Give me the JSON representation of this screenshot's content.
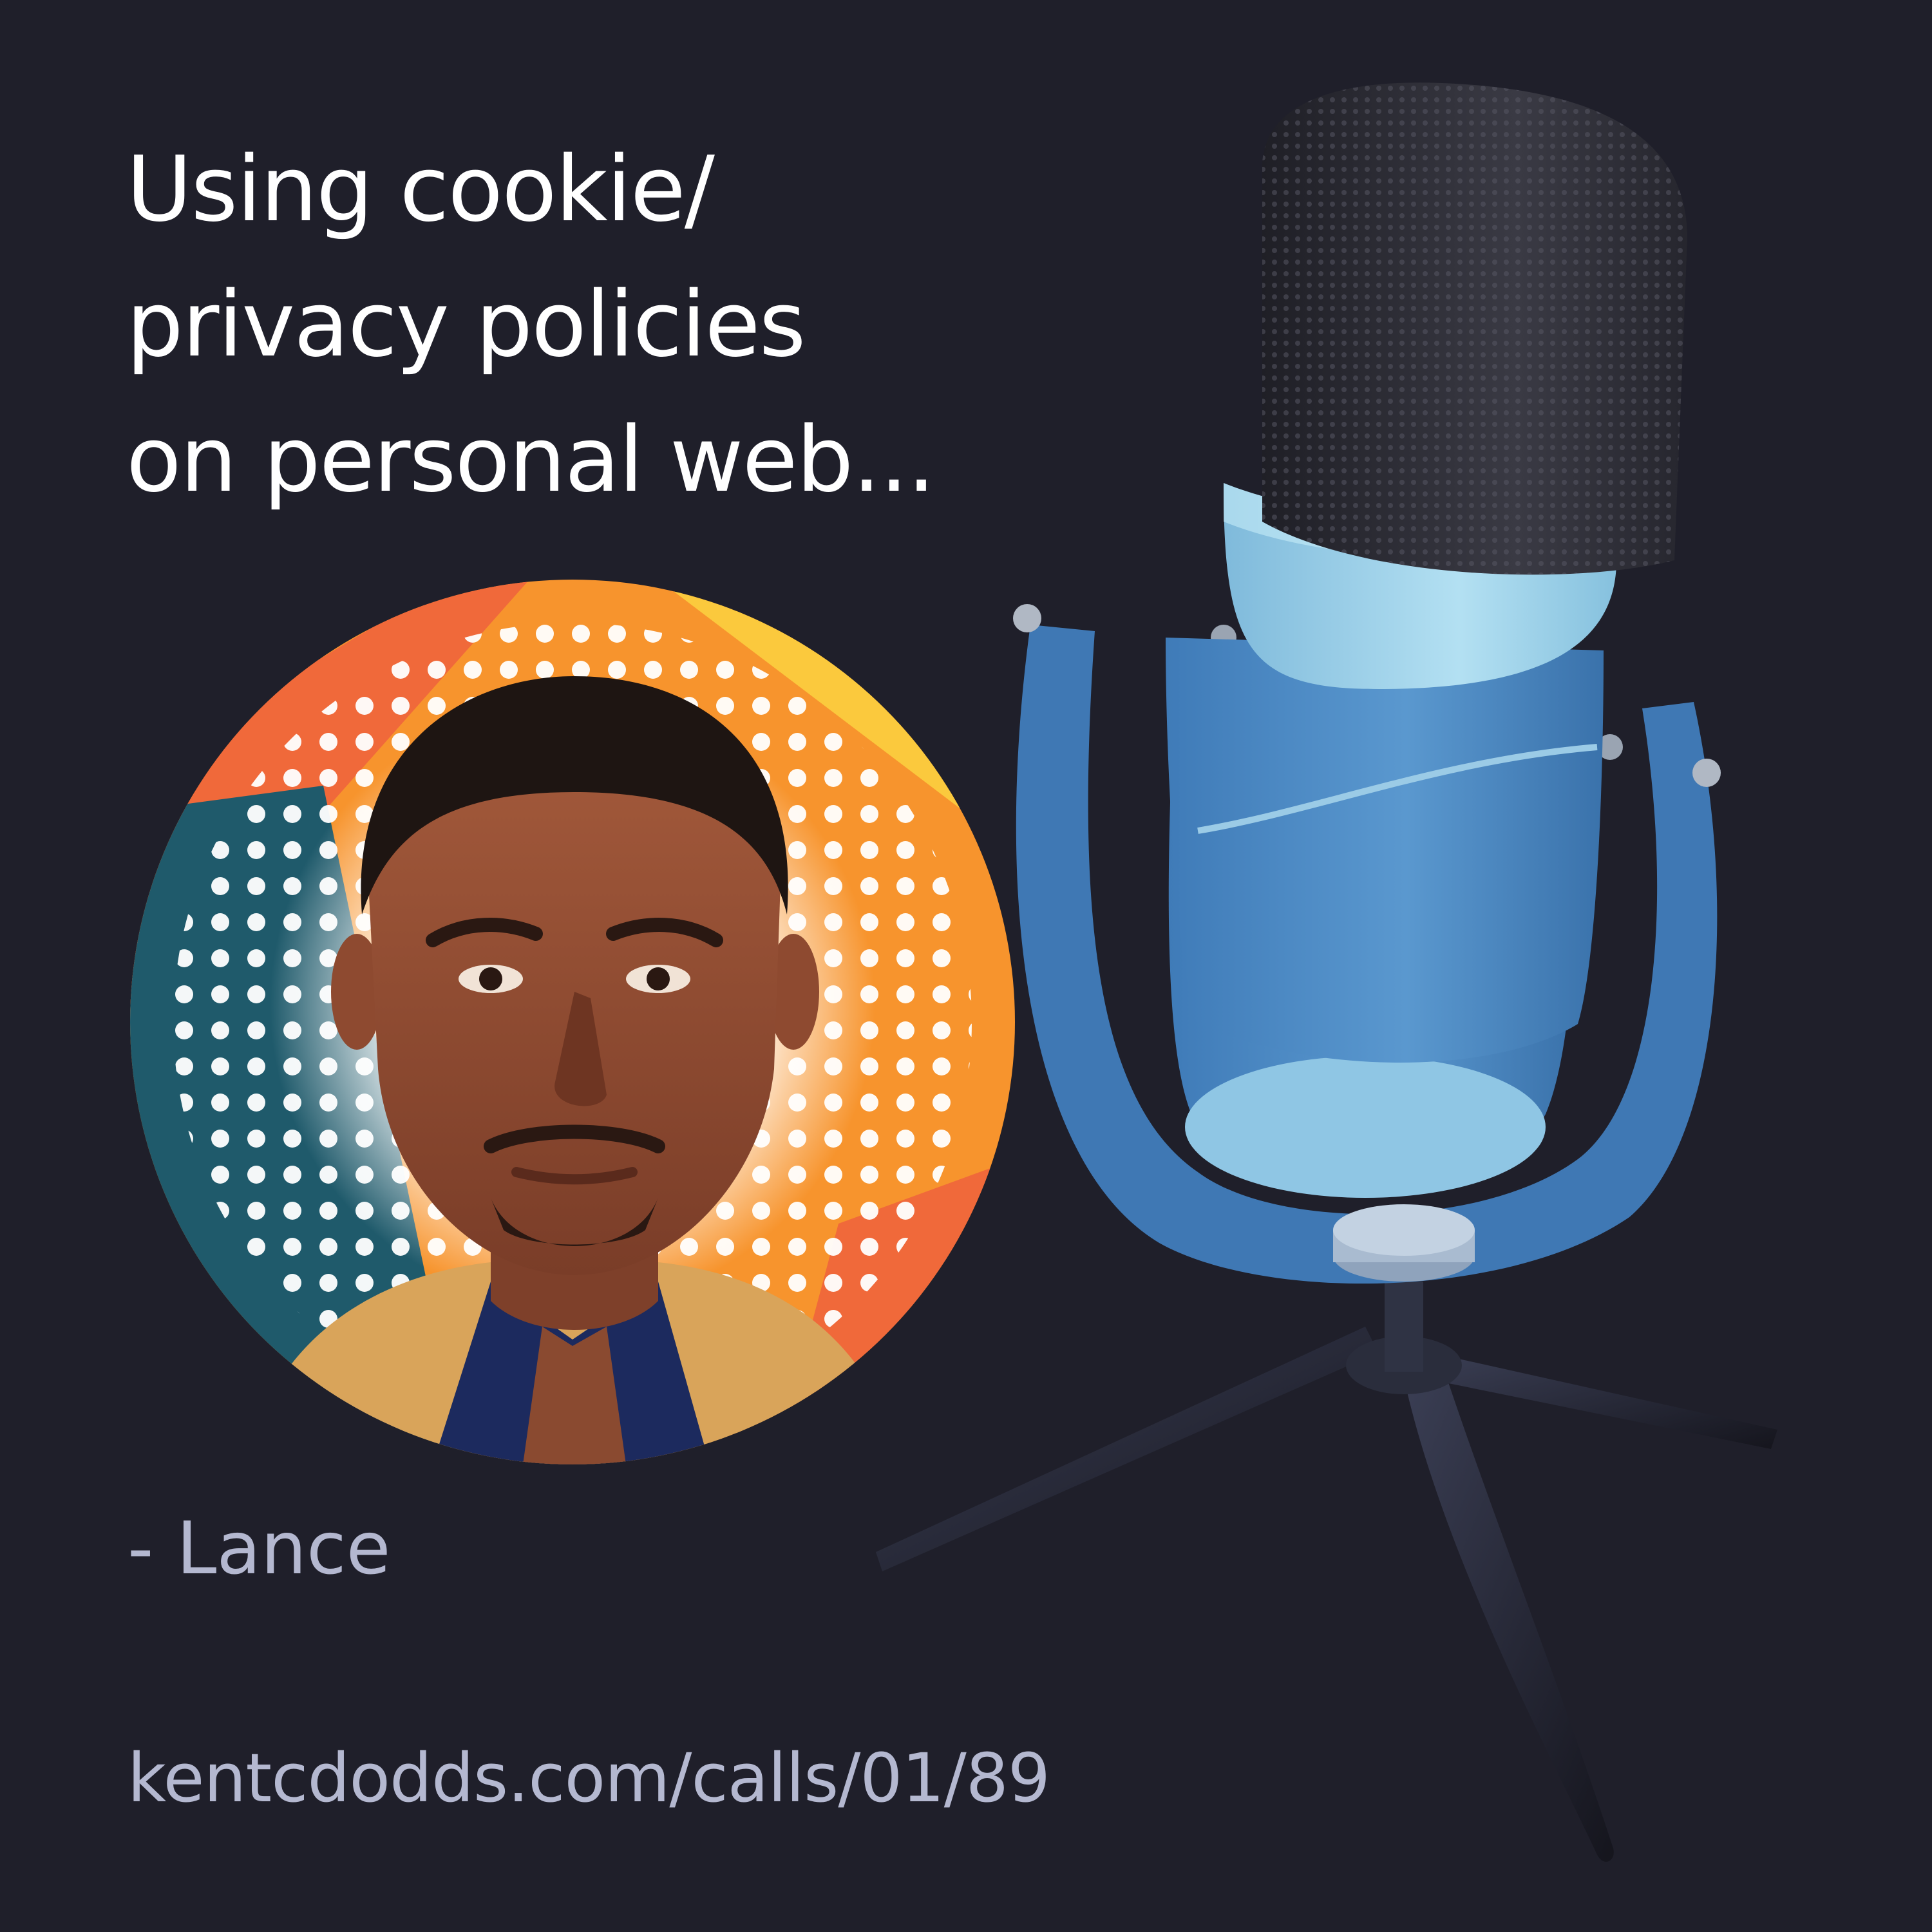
{
  "title": {
    "lines": [
      "Using cookie/",
      "privacy policies",
      "on personal web..."
    ]
  },
  "attribution": "- Lance",
  "url": "kentcdodds.com/calls/01/89",
  "avatar": {
    "icon": "person-photo-icon"
  },
  "illustration": {
    "icon": "podcast-microphone-icon"
  },
  "colors": {
    "background": "#1f1f2a",
    "title": "#ffffff",
    "muted_text": "#b4b8d0",
    "avatar_orange": "#f7942d",
    "avatar_yellow": "#fbc93d",
    "avatar_teal": "#1f5a6b",
    "mic_blue": "#4a88c4",
    "mic_light": "#9fd3ea",
    "mic_grille": "#2b2b33"
  }
}
